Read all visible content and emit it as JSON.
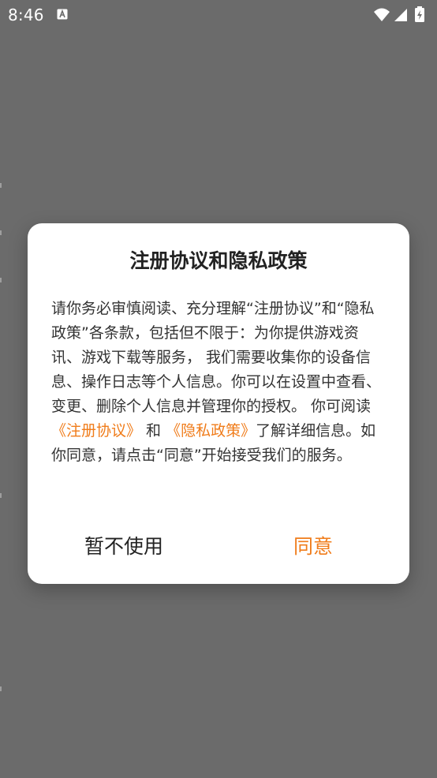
{
  "status_bar": {
    "time": "8:46",
    "notification_icon": "keyboard-a-icon",
    "icons": [
      "wifi-icon",
      "signal-icon",
      "battery-charging-icon"
    ]
  },
  "dialog": {
    "title": "注册协议和隐私政策",
    "body": {
      "part1": "请你务必审慎阅读、充分理解“注册协议”和“隐私政策”各条款，包括但不限于：为你提供游戏资讯、游戏下载等服务， 我们需要收集你的设备信息、操作日志等个人信息。你可以在设置中查看、变更、删除个人信息并管理你的授权。 你可阅读 ",
      "link1": "《注册协议》",
      "mid": " 和 ",
      "link2": "《隐私政策》",
      "part2": "了解详细信息。如你同意，请点击“同意”开始接受我们的服务。"
    },
    "decline_label": "暂不使用",
    "agree_label": "同意"
  },
  "colors": {
    "accent": "#f07c1a",
    "scrim": "#6b6b6b",
    "dialog_bg": "#ffffff"
  }
}
